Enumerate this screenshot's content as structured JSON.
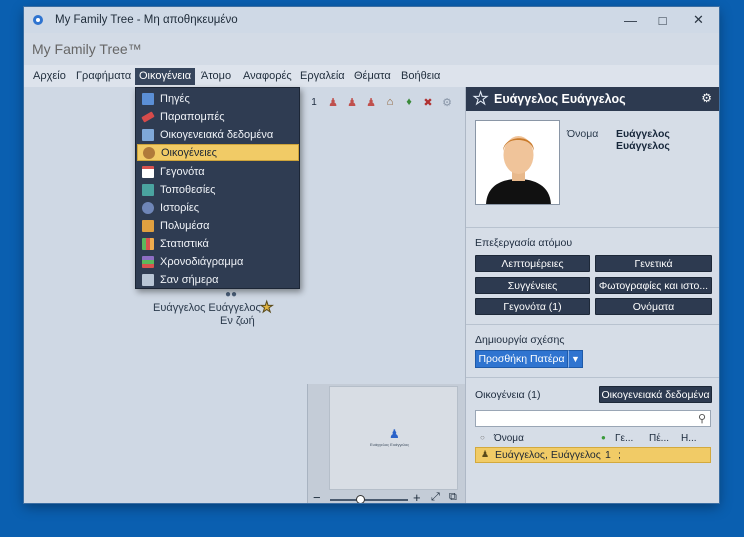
{
  "window": {
    "title": "My Family Tree - Μη αποθηκευμένο"
  },
  "header": {
    "brand": "My Family Tree™"
  },
  "menu": {
    "items": [
      "Αρχείο",
      "Γραφήματα",
      "Οικογένεια",
      "Άτομο",
      "Αναφορές",
      "Εργαλεία",
      "Θέματα",
      "Βοήθεια"
    ],
    "active": "Οικογένεια"
  },
  "dropdown": {
    "items": [
      {
        "label": "Πηγές",
        "icon": "sources-icon",
        "color": "#5b8fd6"
      },
      {
        "label": "Παραπομπές",
        "icon": "citations-icon",
        "color": "#d64b4b"
      },
      {
        "label": "Οικογενειακά δεδομένα",
        "icon": "family-data-icon",
        "color": "#7fa8d8"
      },
      {
        "label": "Οικογένειες",
        "icon": "families-icon",
        "color": "#b07a3a"
      },
      {
        "label": "Γεγονότα",
        "icon": "events-icon",
        "color": "#d9534f"
      },
      {
        "label": "Τοποθεσίες",
        "icon": "places-icon",
        "color": "#4aa3a0"
      },
      {
        "label": "Ιστορίες",
        "icon": "stories-icon",
        "color": "#6f86b8"
      },
      {
        "label": "Πολυμέσα",
        "icon": "media-icon",
        "color": "#e0a040"
      },
      {
        "label": "Στατιστικά",
        "icon": "statistics-icon",
        "color": "#5cb85c"
      },
      {
        "label": "Χρονοδιάγραμμα",
        "icon": "timeline-icon",
        "color": "#8e6fc4"
      },
      {
        "label": "Σαν σήμερα",
        "icon": "on-this-day-icon",
        "color": "#b9c6d6"
      }
    ],
    "selected_index": 3
  },
  "toolbar": {
    "badge": "1"
  },
  "tree": {
    "person_name": "Ευάγγελος Ευάγγελος",
    "person_status": "Εν ζωή"
  },
  "sidepanel": {
    "title": "Ευάγγελος Ευάγγελος",
    "name_label": "Όνομα",
    "name_value": "Ευάγγελος Ευάγγελος",
    "edit_section": "Επεξεργασία ατόμου",
    "buttons": {
      "details": "Λεπτομέρειες",
      "genetics": "Γενετικά",
      "relatives": "Συγγένειες",
      "photos": "Φωτογραφίες και ιστο...",
      "events": "Γεγονότα (1)",
      "names": "Ονόματα"
    },
    "relation_section": "Δημιουργία σχέσης",
    "add_father": "Προσθήκη Πατέρα",
    "family_label": "Οικογένεια (1)",
    "family_data_button": "Οικογενειακά δεδομένα",
    "grid": {
      "columns": [
        "Όνομα",
        "Γε...",
        "Πέ...",
        "Η..."
      ],
      "row": {
        "name": "Ευάγγελος, Ευάγγελος",
        "col2": "1",
        "col3": ";"
      }
    }
  }
}
